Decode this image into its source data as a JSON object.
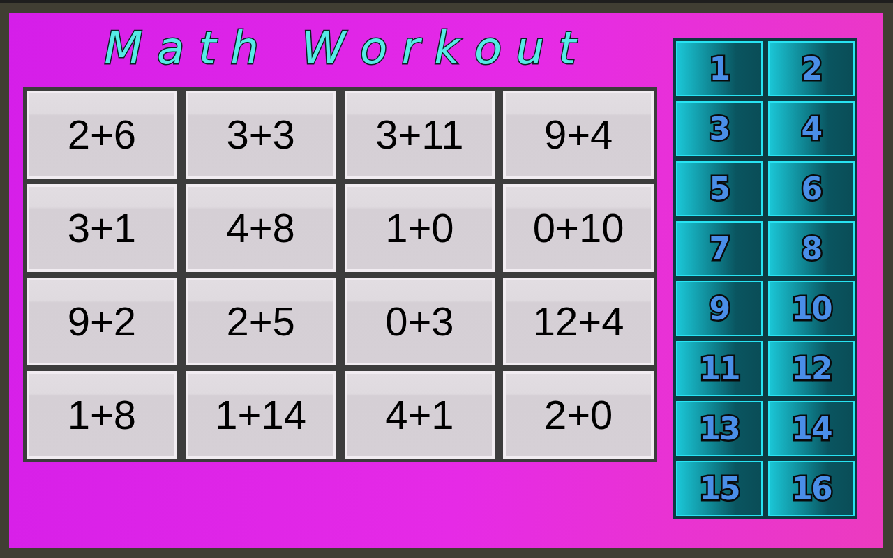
{
  "title": "Math Workout",
  "problems": [
    "2+6",
    "3+3",
    "3+11",
    "9+4",
    "3+1",
    "4+8",
    "1+0",
    "0+10",
    "9+2",
    "2+5",
    "0+3",
    "12+4",
    "1+8",
    "1+14",
    "4+1",
    "2+0"
  ],
  "number_buttons": [
    "1",
    "2",
    "3",
    "4",
    "5",
    "6",
    "7",
    "8",
    "9",
    "10",
    "11",
    "12",
    "13",
    "14",
    "15",
    "16"
  ]
}
